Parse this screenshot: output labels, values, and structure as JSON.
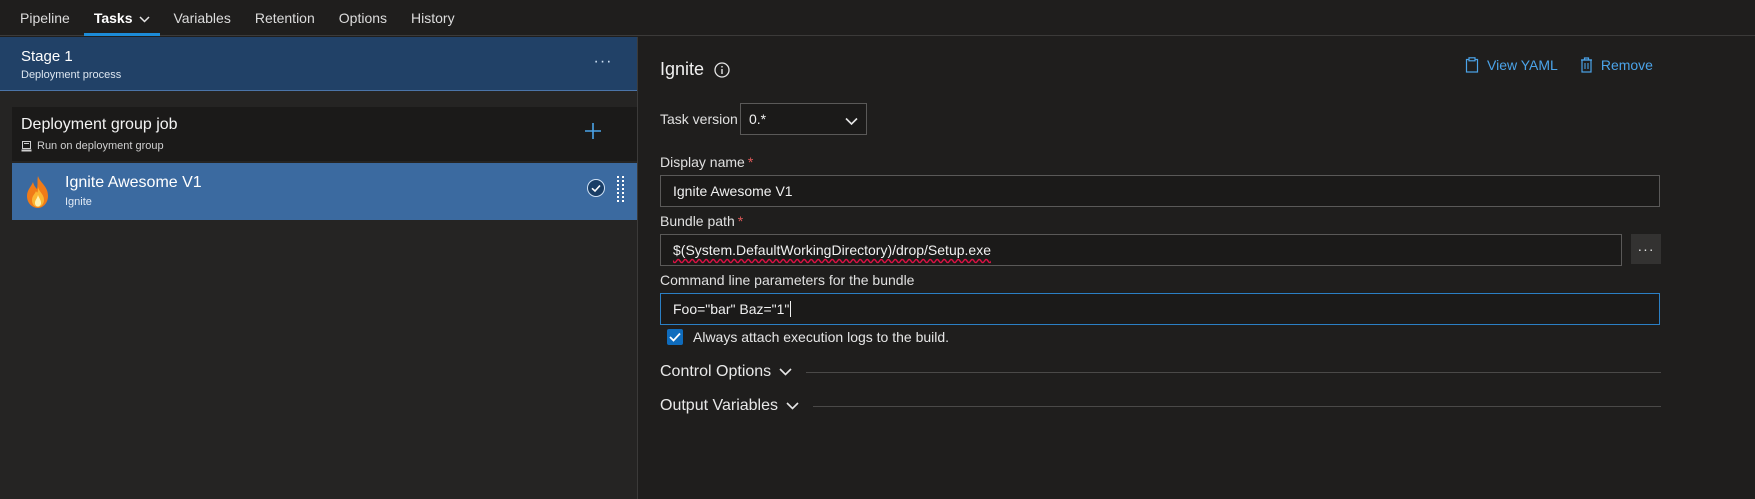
{
  "tabs": [
    {
      "label": "Pipeline"
    },
    {
      "label": "Tasks"
    },
    {
      "label": "Variables"
    },
    {
      "label": "Retention"
    },
    {
      "label": "Options"
    },
    {
      "label": "History"
    }
  ],
  "stage": {
    "title": "Stage 1",
    "subtitle": "Deployment process",
    "more": "···"
  },
  "job": {
    "title": "Deployment group job",
    "subtitle": "Run on deployment group"
  },
  "task": {
    "title": "Ignite Awesome V1",
    "subtitle": "Ignite"
  },
  "detail": {
    "title": "Ignite",
    "view_yaml": "View YAML",
    "remove": "Remove",
    "task_version_label": "Task version",
    "task_version_value": "0.*",
    "display_name_label": "Display name",
    "display_name_value": "Ignite Awesome V1",
    "bundle_path_label": "Bundle path",
    "bundle_path_value": "$(System.DefaultWorkingDirectory)/drop/Setup.exe",
    "cmd_label": "Command line parameters for the bundle",
    "cmd_value": "Foo=\"bar\" Baz=\"1\"",
    "required_mark": "*",
    "attach_logs_label": "Always attach execution logs to the build.",
    "attach_logs_checked": true,
    "browse": "···",
    "control_options": "Control Options",
    "output_variables": "Output Variables"
  },
  "colors": {
    "accent": "#1c8bd8",
    "link": "#4ba3e8",
    "selected": "#3b6aa0",
    "stage": "#214167",
    "required": "#e05a5a"
  }
}
